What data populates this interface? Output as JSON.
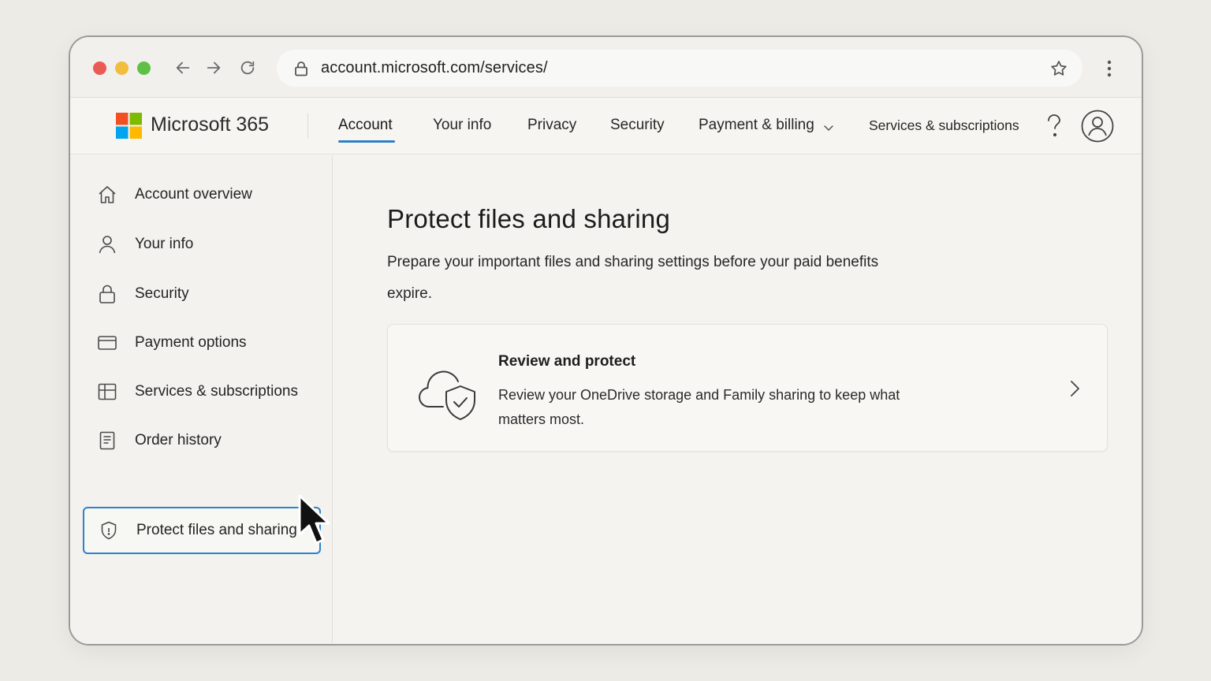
{
  "browser": {
    "url": "account.microsoft.com/services/"
  },
  "header": {
    "brand": "Microsoft 365",
    "nav": [
      {
        "label": "Account"
      },
      {
        "label": "Your info"
      },
      {
        "label": "Privacy"
      },
      {
        "label": "Security"
      },
      {
        "label": "Payment & billing"
      },
      {
        "label": "Services & subscriptions"
      }
    ],
    "active_nav": "Account",
    "help_icon": "question-mark-icon",
    "avatar_icon": "user-avatar-icon"
  },
  "sidebar": {
    "items": [
      {
        "label": "Account overview",
        "icon": "home-icon"
      },
      {
        "label": "Your info",
        "icon": "person-icon"
      },
      {
        "label": "Security",
        "icon": "lock-icon"
      },
      {
        "label": "Payment options",
        "icon": "credit-card-icon"
      },
      {
        "label": "Services & subscriptions",
        "icon": "grid-icon"
      },
      {
        "label": "Order history",
        "icon": "receipt-icon"
      },
      {
        "label": "Protect files and sharing",
        "icon": "shield-icon"
      }
    ],
    "selected": "Protect files and sharing"
  },
  "main": {
    "title": "Protect files and sharing",
    "description": "Prepare your important files and sharing settings before your paid benefits expire.",
    "card": {
      "title": "Review and protect",
      "description": "Review your OneDrive storage and Family sharing to keep what matters most.",
      "icon": "cloud-shield-icon"
    }
  },
  "colors": {
    "accent": "#2e82cc",
    "close": "#ea5b55",
    "minimize": "#f2bc3d",
    "maximize": "#5ec145"
  }
}
